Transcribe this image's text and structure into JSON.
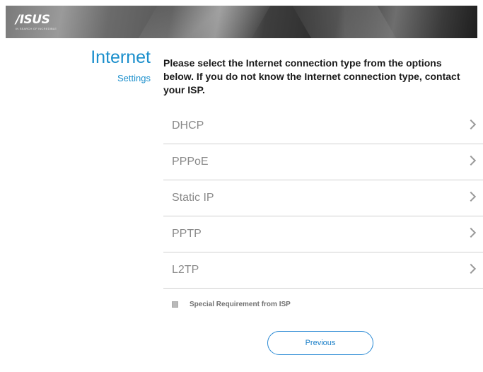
{
  "header": {
    "logo_text": "/ISUS",
    "logo_tagline": "IN SEARCH OF INCREDIBLE"
  },
  "section": {
    "title": "Internet",
    "subtitle": "Settings"
  },
  "instruction": "Please select the Internet connection type from the options below. If you do not know the Internet connection type, contact your ISP.",
  "options": [
    {
      "label": "DHCP",
      "icon": "chevron-right-icon"
    },
    {
      "label": "PPPoE",
      "icon": "chevron-right-icon"
    },
    {
      "label": "Static IP",
      "icon": "chevron-right-icon"
    },
    {
      "label": "PPTP",
      "icon": "chevron-right-icon"
    },
    {
      "label": "L2TP",
      "icon": "chevron-right-icon"
    }
  ],
  "special_requirement": {
    "label": "Special Requirement from ISP",
    "checked": false
  },
  "buttons": {
    "previous": "Previous"
  },
  "colors": {
    "accent": "#1b8fcc",
    "option_text": "#8a8a8a",
    "button_border": "#2a8ad4"
  }
}
